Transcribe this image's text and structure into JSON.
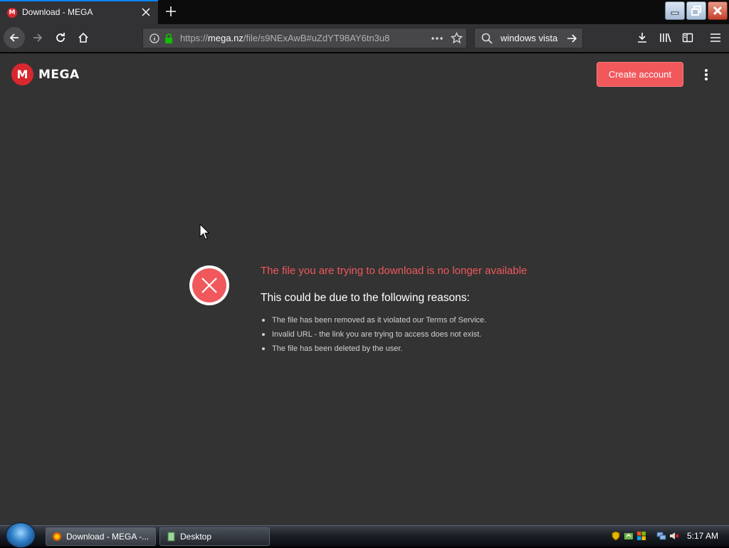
{
  "browser": {
    "tab_title": "Download - MEGA",
    "tab_favicon_letter": "M",
    "url_prefix": "https://",
    "url_domain": "mega.nz",
    "url_path": "/file/s9NExAwB#uZdYT98AY6tn3u8",
    "search_value": "windows vista"
  },
  "mega": {
    "logo_letter": "M",
    "logo_text": "MEGA",
    "create_account_label": "Create account",
    "error_title": "The file you are trying to download is no longer available",
    "error_subtitle": "This could be due to the following reasons:",
    "reasons": [
      "The file has been removed as it violated our Terms of Service.",
      "Invalid URL - the link you are trying to access does not exist.",
      "The file has been deleted by the user."
    ],
    "accent_color": "#f0585c"
  },
  "taskbar": {
    "items": [
      {
        "label": "Download - MEGA -...",
        "icon": "firefox-icon"
      },
      {
        "label": "Desktop",
        "icon": "folder-icon"
      }
    ],
    "clock": "5:17 AM"
  }
}
